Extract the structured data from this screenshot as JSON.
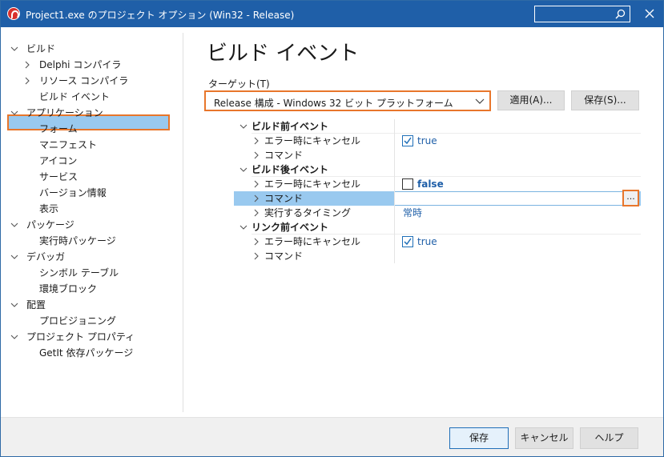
{
  "window": {
    "title": "Project1.exe のプロジェクト オプション  (Win32 - Release)",
    "search_placeholder": ""
  },
  "tree": {
    "items": [
      {
        "label": "ビルド",
        "expanded": true
      },
      {
        "label": "Delphi コンパイラ",
        "expanded": false
      },
      {
        "label": "リソース コンパイラ",
        "expanded": false
      },
      {
        "label": "ビルド イベント",
        "selected": true
      },
      {
        "label": "アプリケーション",
        "expanded": true
      },
      {
        "label": "フォーム"
      },
      {
        "label": "マニフェスト"
      },
      {
        "label": "アイコン"
      },
      {
        "label": "サービス"
      },
      {
        "label": "バージョン情報"
      },
      {
        "label": "表示"
      },
      {
        "label": "パッケージ",
        "expanded": true
      },
      {
        "label": "実行時パッケージ"
      },
      {
        "label": "デバッガ",
        "expanded": true
      },
      {
        "label": "シンボル テーブル"
      },
      {
        "label": "環境ブロック"
      },
      {
        "label": "配置",
        "expanded": true
      },
      {
        "label": "プロビジョニング"
      },
      {
        "label": "プロジェクト プロパティ",
        "expanded": true
      },
      {
        "label": "GetIt 依存パッケージ"
      }
    ]
  },
  "main": {
    "title": "ビルド イベント",
    "target_label": "ターゲット(T)",
    "target_value": "Release 構成 - Windows 32 ビット プラットフォーム",
    "apply_label": "適用(A)...",
    "save_label": "保存(S)..."
  },
  "grid": {
    "groups": [
      {
        "label": "ビルド前イベント",
        "rows": [
          {
            "name": "エラー時にキャンセル",
            "value": "true",
            "checked": true
          },
          {
            "name": "コマンド",
            "value": ""
          }
        ]
      },
      {
        "label": "ビルド後イベント",
        "rows": [
          {
            "name": "エラー時にキャンセル",
            "value": "false",
            "checked": false
          },
          {
            "name": "コマンド",
            "value": "",
            "selected": true,
            "button": "..."
          },
          {
            "name": "実行するタイミング",
            "value": "常時"
          }
        ]
      },
      {
        "label": "リンク前イベント",
        "rows": [
          {
            "name": "エラー時にキャンセル",
            "value": "true",
            "checked": true
          },
          {
            "name": "コマンド",
            "value": ""
          }
        ]
      }
    ]
  },
  "footer": {
    "save_label": "保存",
    "cancel_label": "キャンセル",
    "help_label": "ヘルプ"
  },
  "colors": {
    "titlebar": "#1f5fa8",
    "highlight_border": "#e8762b",
    "selection": "#99c9ef",
    "value_text": "#1f5fa8"
  }
}
